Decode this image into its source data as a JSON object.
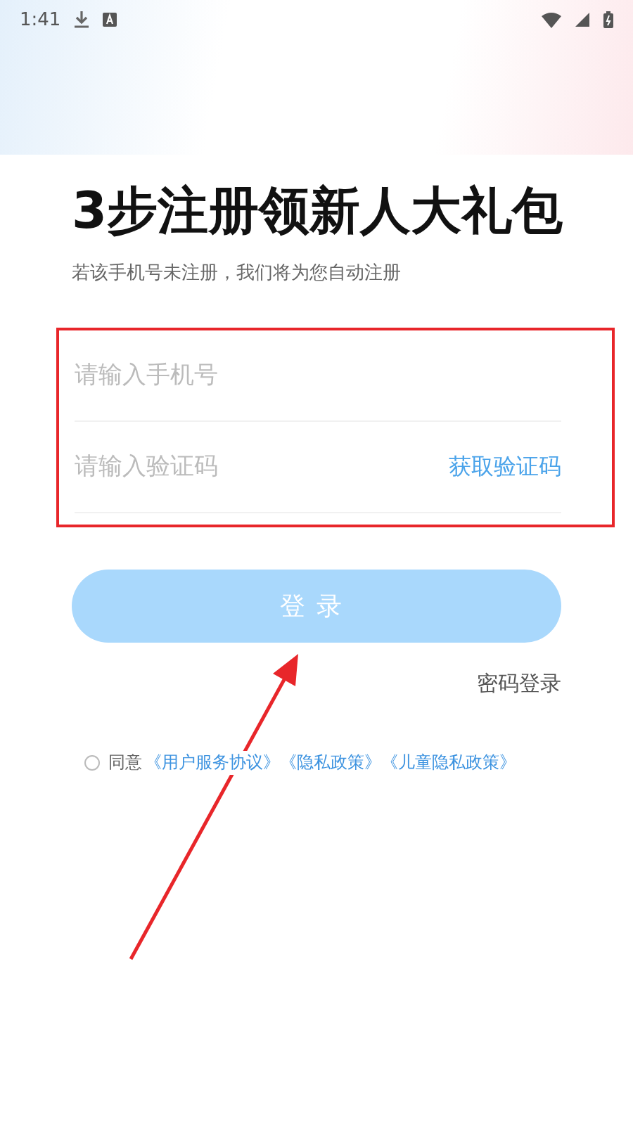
{
  "status_bar": {
    "time": "1:41"
  },
  "title": "3步注册领新人大礼包",
  "subtitle": "若该手机号未注册，我们将为您自动注册",
  "phone_field": {
    "placeholder": "请输入手机号"
  },
  "code_field": {
    "placeholder": "请输入验证码",
    "action": "获取验证码"
  },
  "login_button": "登录",
  "password_login": "密码登录",
  "agreement": {
    "checked": false,
    "label": "同意",
    "links": [
      "《用户服务协议》",
      "《隐私政策》",
      "《儿童隐私政策》"
    ]
  }
}
